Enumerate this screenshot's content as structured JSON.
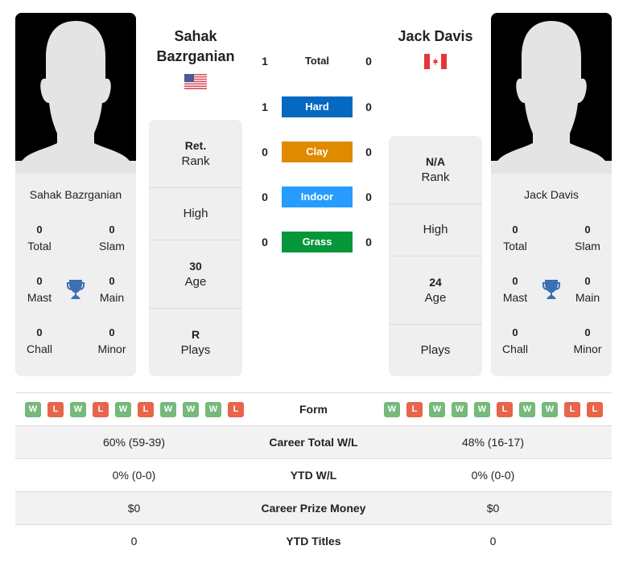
{
  "player_left": {
    "name": "Sahak Bazrganian",
    "name_line1": "Sahak",
    "name_line2": "Bazrganian",
    "country": "USA",
    "flag_icon": "us-flag-icon",
    "stats": {
      "total": {
        "value": "0",
        "label": "Total"
      },
      "slam": {
        "value": "0",
        "label": "Slam"
      },
      "mast": {
        "value": "0",
        "label": "Mast"
      },
      "main": {
        "value": "0",
        "label": "Main"
      },
      "chall": {
        "value": "0",
        "label": "Chall"
      },
      "minor": {
        "value": "0",
        "label": "Minor"
      }
    },
    "info": {
      "rank": {
        "value": "Ret.",
        "label": "Rank"
      },
      "high": {
        "value": "",
        "label": "High"
      },
      "age": {
        "value": "30",
        "label": "Age"
      },
      "plays": {
        "value": "R",
        "label": "Plays"
      }
    },
    "form": [
      "W",
      "L",
      "W",
      "L",
      "W",
      "L",
      "W",
      "W",
      "W",
      "L"
    ],
    "career_total_wl": "60% (59-39)",
    "ytd_wl": "0% (0-0)",
    "career_prize_money": "$0",
    "ytd_titles": "0"
  },
  "player_right": {
    "name": "Jack Davis",
    "country": "Canada",
    "flag_icon": "canada-flag-icon",
    "stats": {
      "total": {
        "value": "0",
        "label": "Total"
      },
      "slam": {
        "value": "0",
        "label": "Slam"
      },
      "mast": {
        "value": "0",
        "label": "Mast"
      },
      "main": {
        "value": "0",
        "label": "Main"
      },
      "chall": {
        "value": "0",
        "label": "Chall"
      },
      "minor": {
        "value": "0",
        "label": "Minor"
      }
    },
    "info": {
      "rank": {
        "value": "N/A",
        "label": "Rank"
      },
      "high": {
        "value": "",
        "label": "High"
      },
      "age": {
        "value": "24",
        "label": "Age"
      },
      "plays": {
        "value": "",
        "label": "Plays"
      }
    },
    "form": [
      "W",
      "L",
      "W",
      "W",
      "W",
      "L",
      "W",
      "W",
      "L",
      "L"
    ],
    "career_total_wl": "48% (16-17)",
    "ytd_wl": "0% (0-0)",
    "career_prize_money": "$0",
    "ytd_titles": "0"
  },
  "h2h": [
    {
      "label": "Total",
      "left": "1",
      "right": "0",
      "color": ""
    },
    {
      "label": "Hard",
      "left": "1",
      "right": "0",
      "color": "#0569c1"
    },
    {
      "label": "Clay",
      "left": "0",
      "right": "0",
      "color": "#e08a00"
    },
    {
      "label": "Indoor",
      "left": "0",
      "right": "0",
      "color": "#279cff"
    },
    {
      "label": "Grass",
      "left": "0",
      "right": "0",
      "color": "#05973a"
    }
  ],
  "table_labels": {
    "form": "Form",
    "career_total_wl": "Career Total W/L",
    "ytd_wl": "YTD W/L",
    "career_prize_money": "Career Prize Money",
    "ytd_titles": "YTD Titles"
  },
  "colors": {
    "win": "#75b97b",
    "loss": "#e8644a",
    "trophy": "#3b6fb6"
  }
}
